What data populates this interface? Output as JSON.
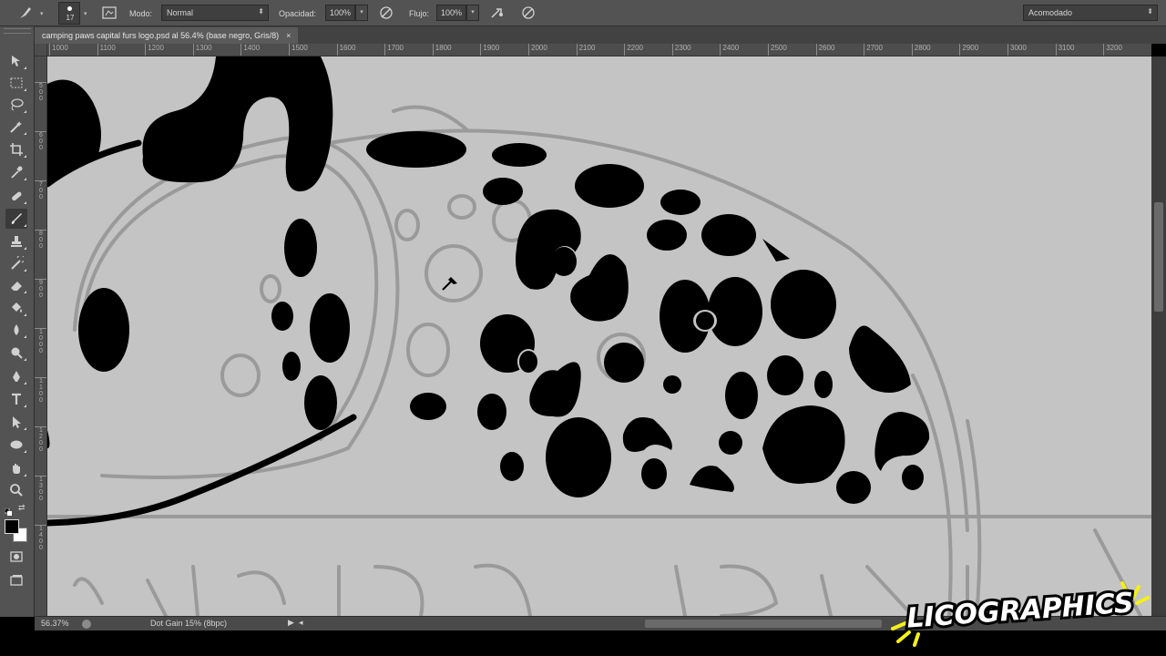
{
  "options_bar": {
    "brush_size": "17",
    "mode_label": "Modo:",
    "mode_value": "Normal",
    "opacity_label": "Opacidad:",
    "opacity_value": "100%",
    "flow_label": "Flujo:",
    "flow_value": "100%",
    "workspace_value": "Acomodado"
  },
  "document": {
    "tab_title": "camping paws capital furs logo.psd al 56.4% (base negro, Gris/8)",
    "close_glyph": "×"
  },
  "ruler": {
    "h_ticks": [
      "1000",
      "1100",
      "1200",
      "1300",
      "1400",
      "1500",
      "1600",
      "1700",
      "1800",
      "1900",
      "2000",
      "2100",
      "2200",
      "2300",
      "2400",
      "2500",
      "2600",
      "2700",
      "2800",
      "2900",
      "3000",
      "3100",
      "3200"
    ],
    "v_ticks": [
      "500",
      "600",
      "700",
      "800",
      "900",
      "1000",
      "1100",
      "1200",
      "1300",
      "1400"
    ]
  },
  "status": {
    "zoom": "56.37%",
    "doc_info": "Dot Gain 15% (8bpc)"
  },
  "tools": [
    "move-tool",
    "marquee-tool",
    "lasso-tool",
    "magic-wand-tool",
    "crop-tool",
    "eyedropper-tool",
    "healing-brush-tool",
    "brush-tool",
    "clone-stamp-tool",
    "history-brush-tool",
    "eraser-tool",
    "paint-bucket-tool",
    "blur-tool",
    "dodge-tool",
    "pen-tool",
    "type-tool",
    "path-selection-tool",
    "ellipse-tool",
    "hand-tool",
    "zoom-tool"
  ],
  "colors": {
    "foreground": "#000000",
    "background": "#ffffff",
    "canvas": "#c4c4c4",
    "panel": "#535353"
  },
  "watermark": {
    "text": "LICOGRAPHICS"
  }
}
